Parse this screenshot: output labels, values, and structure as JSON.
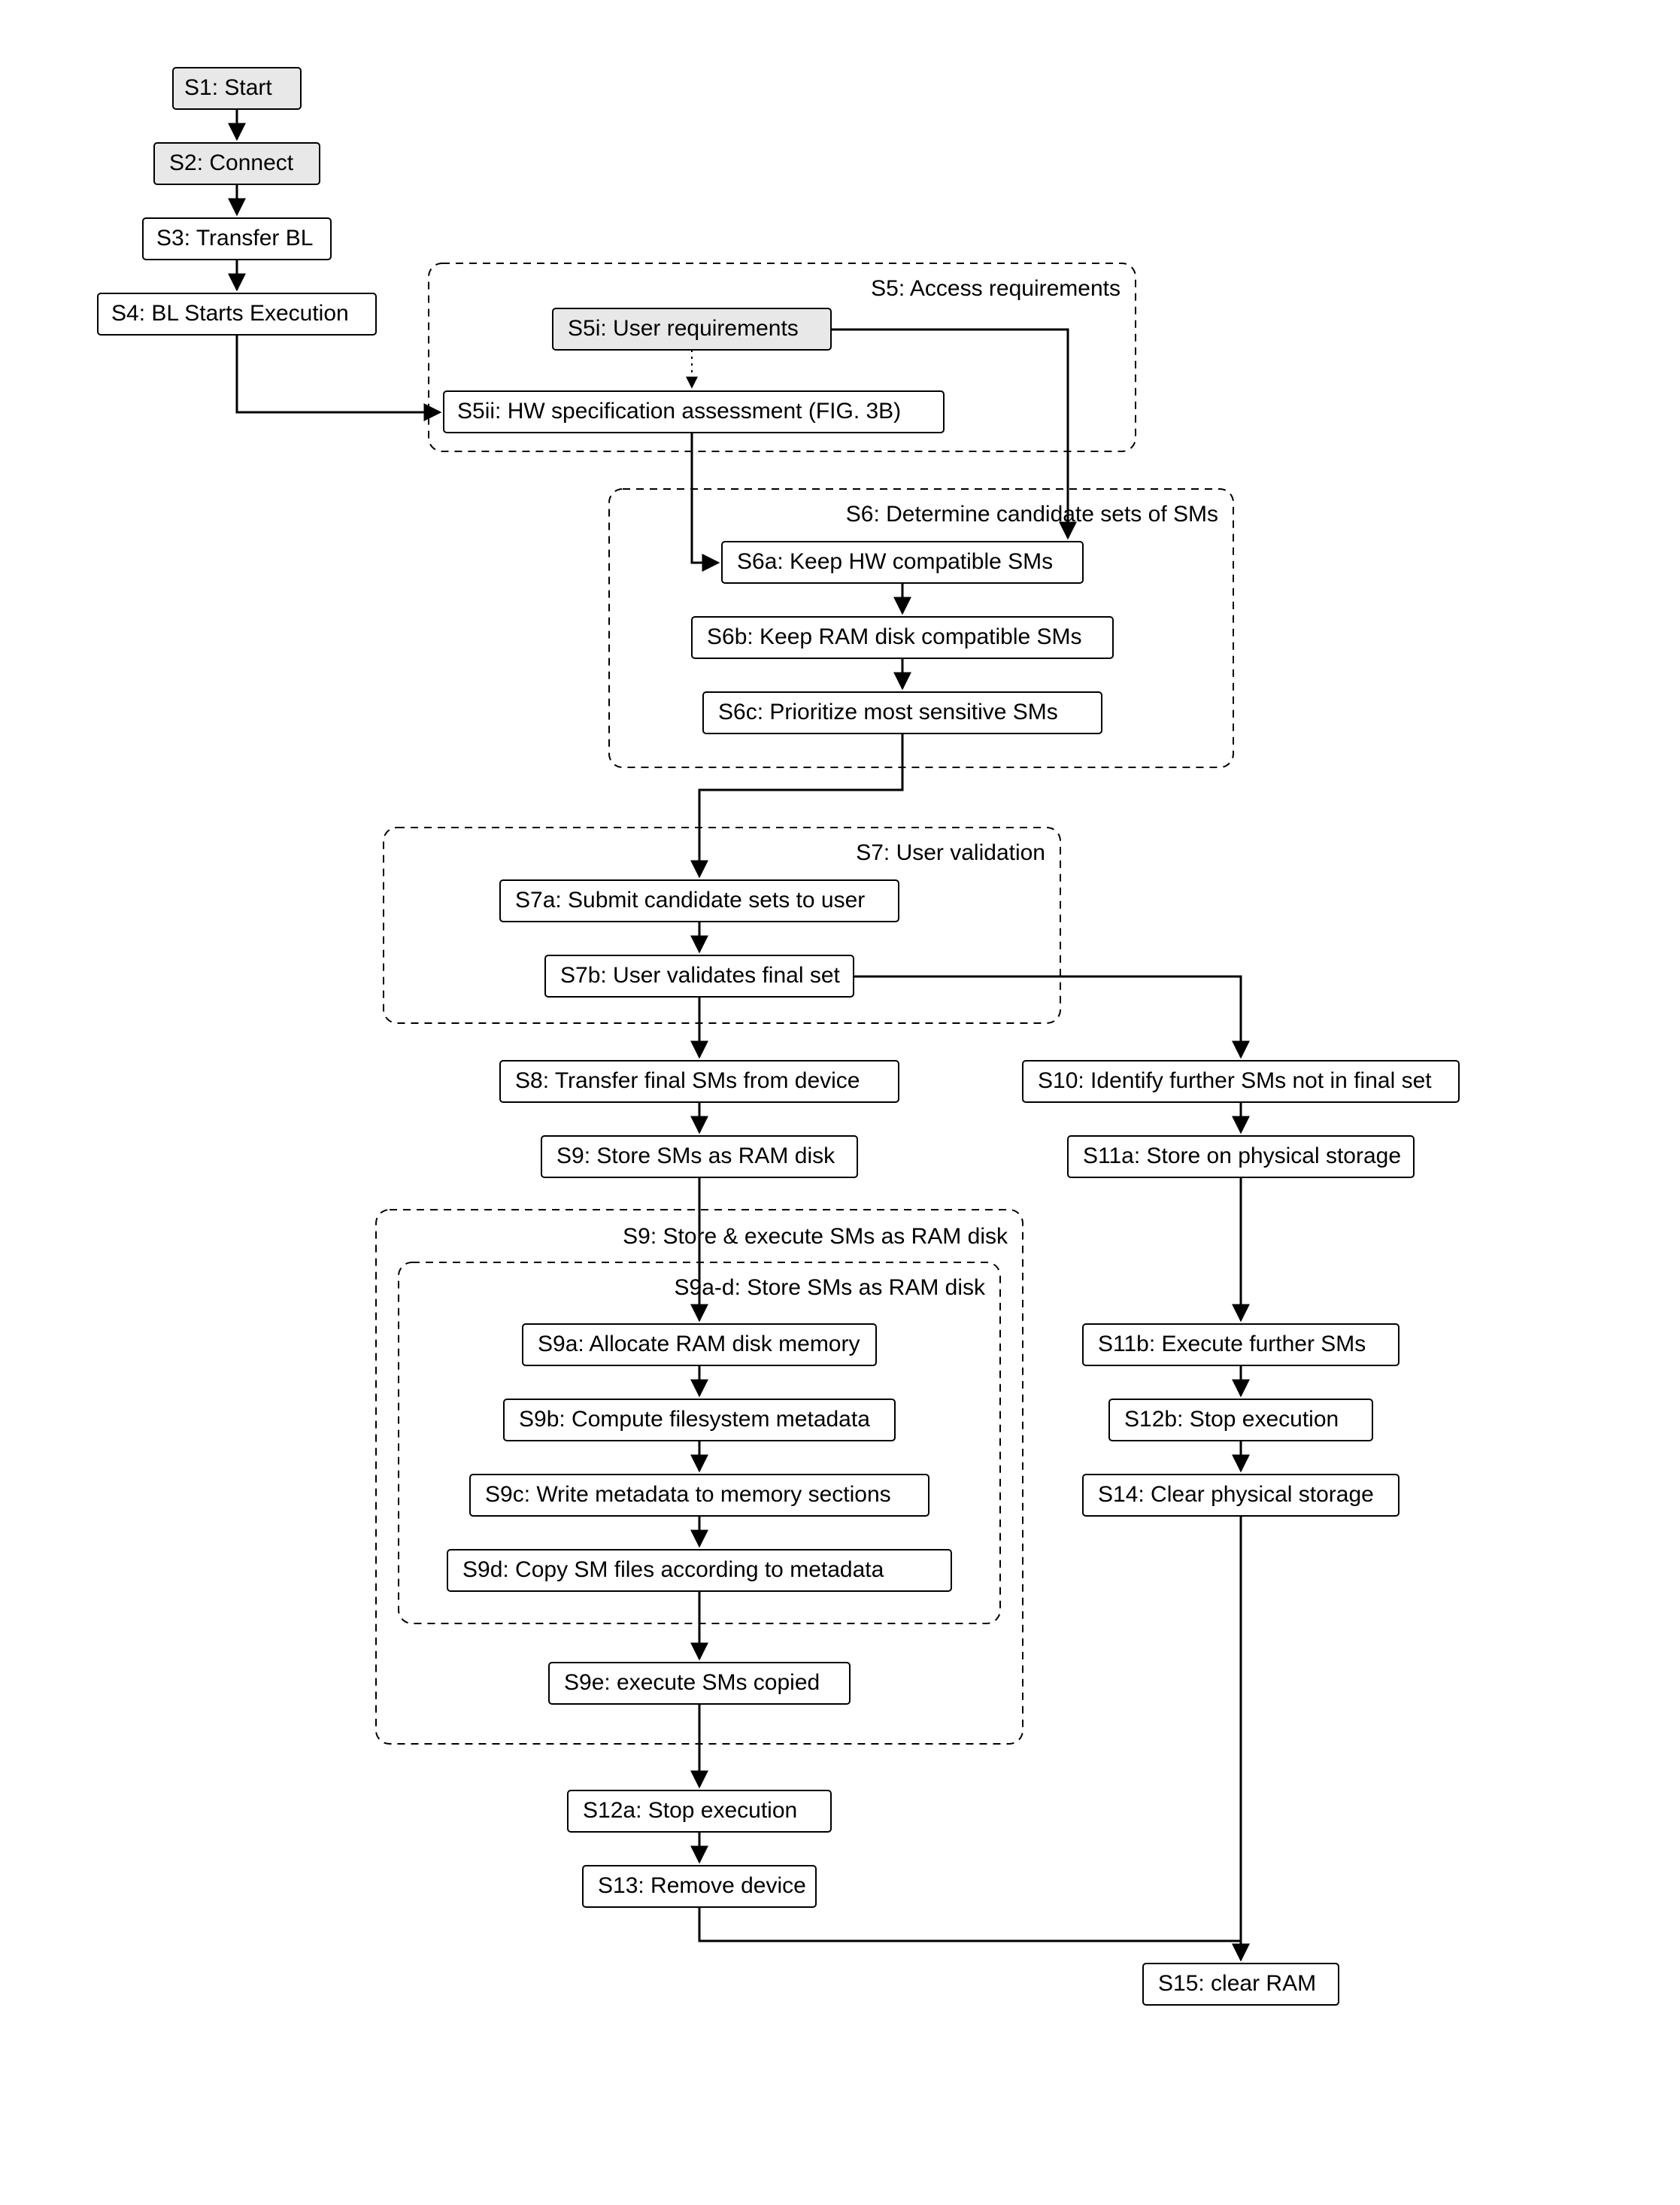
{
  "chart_data": {
    "type": "flowchart",
    "nodes": [
      {
        "id": "S1",
        "label": "S1: Start"
      },
      {
        "id": "S2",
        "label": "S2: Connect"
      },
      {
        "id": "S3",
        "label": "S3: Transfer BL"
      },
      {
        "id": "S4",
        "label": "S4: BL Starts Execution"
      },
      {
        "id": "S5",
        "label": "S5: Access requirements",
        "group": true,
        "children": [
          "S5i",
          "S5ii"
        ]
      },
      {
        "id": "S5i",
        "label": "S5i: User requirements"
      },
      {
        "id": "S5ii",
        "label": "S5ii: HW specification assessment (FIG. 3B)"
      },
      {
        "id": "S6",
        "label": "S6: Determine candidate sets of SMs",
        "group": true,
        "children": [
          "S6a",
          "S6b",
          "S6c"
        ]
      },
      {
        "id": "S6a",
        "label": "S6a: Keep HW compatible SMs"
      },
      {
        "id": "S6b",
        "label": "S6b: Keep RAM disk compatible SMs"
      },
      {
        "id": "S6c",
        "label": "S6c: Prioritize most sensitive SMs"
      },
      {
        "id": "S7",
        "label": "S7: User validation",
        "group": true,
        "children": [
          "S7a",
          "S7b"
        ]
      },
      {
        "id": "S7a",
        "label": "S7a: Submit candidate sets to user"
      },
      {
        "id": "S7b",
        "label": "S7b: User validates final set"
      },
      {
        "id": "S8",
        "label": "S8: Transfer final SMs from device"
      },
      {
        "id": "S9t",
        "label": "S9: Store SMs as RAM disk"
      },
      {
        "id": "S9g",
        "label": "S9: Store & execute SMs as RAM disk",
        "group": true,
        "children": [
          "S9ad",
          "S9e"
        ]
      },
      {
        "id": "S9ad",
        "label": "S9a-d: Store SMs as RAM disk",
        "group": true,
        "children": [
          "S9a",
          "S9b",
          "S9c",
          "S9d"
        ]
      },
      {
        "id": "S9a",
        "label": "S9a: Allocate RAM disk memory"
      },
      {
        "id": "S9b",
        "label": "S9b: Compute filesystem metadata"
      },
      {
        "id": "S9c",
        "label": "S9c: Write metadata to memory sections"
      },
      {
        "id": "S9d",
        "label": "S9d: Copy SM files according to metadata"
      },
      {
        "id": "S9e",
        "label": "S9e: execute SMs copied"
      },
      {
        "id": "S12a",
        "label": "S12a: Stop execution"
      },
      {
        "id": "S13",
        "label": "S13: Remove device"
      },
      {
        "id": "S10",
        "label": "S10: Identify further SMs not in final set"
      },
      {
        "id": "S11a",
        "label": "S11a: Store on physical storage"
      },
      {
        "id": "S11b",
        "label": "S11b: Execute further SMs"
      },
      {
        "id": "S12b",
        "label": "S12b: Stop execution"
      },
      {
        "id": "S14",
        "label": "S14: Clear physical storage"
      },
      {
        "id": "S15",
        "label": "S15: clear RAM"
      }
    ],
    "edges": [
      [
        "S1",
        "S2"
      ],
      [
        "S2",
        "S3"
      ],
      [
        "S3",
        "S4"
      ],
      [
        "S4",
        "S5ii"
      ],
      [
        "S5i",
        "S5ii",
        "dotted"
      ],
      [
        "S5i",
        "S6a"
      ],
      [
        "S5ii",
        "S6a"
      ],
      [
        "S6a",
        "S6b"
      ],
      [
        "S6b",
        "S6c"
      ],
      [
        "S6c",
        "S7a"
      ],
      [
        "S7a",
        "S7b"
      ],
      [
        "S7b",
        "S8"
      ],
      [
        "S8",
        "S9t"
      ],
      [
        "S9t",
        "S9a"
      ],
      [
        "S9a",
        "S9b"
      ],
      [
        "S9b",
        "S9c"
      ],
      [
        "S9c",
        "S9d"
      ],
      [
        "S9d",
        "S9e"
      ],
      [
        "S9e",
        "S12a"
      ],
      [
        "S12a",
        "S13"
      ],
      [
        "S13",
        "S15"
      ],
      [
        "S7b",
        "S10"
      ],
      [
        "S10",
        "S11a"
      ],
      [
        "S11a",
        "S11b"
      ],
      [
        "S11b",
        "S12b"
      ],
      [
        "S12b",
        "S14"
      ],
      [
        "S14",
        "S15"
      ]
    ]
  },
  "n": {
    "s1": "S1: Start",
    "s2": "S2: Connect",
    "s3": "S3: Transfer BL",
    "s4": "S4: BL Starts Execution",
    "s5": "S5: Access requirements",
    "s5i": "S5i: User requirements",
    "s5ii": "S5ii: HW specification assessment (FIG. 3B)",
    "s6": "S6: Determine candidate sets of SMs",
    "s6a": "S6a: Keep HW compatible SMs",
    "s6b": "S6b: Keep RAM disk compatible SMs",
    "s6c": "S6c: Prioritize most sensitive SMs",
    "s7": "S7: User validation",
    "s7a": "S7a: Submit candidate sets to user",
    "s7b": "S7b: User validates final set",
    "s8": "S8: Transfer final SMs from device",
    "s9t": "S9: Store SMs as RAM disk",
    "s9g": "S9: Store & execute SMs as RAM disk",
    "s9ad": "S9a-d: Store SMs as RAM disk",
    "s9a": "S9a: Allocate RAM disk memory",
    "s9b": "S9b: Compute filesystem metadata",
    "s9c": "S9c: Write metadata to memory sections",
    "s9d": "S9d: Copy SM files according to metadata",
    "s9e": "S9e: execute SMs copied",
    "s12a": "S12a: Stop execution",
    "s13": "S13: Remove device",
    "s10": "S10: Identify further SMs not in final set",
    "s11a": "S11a: Store on physical storage",
    "s11b": "S11b: Execute further SMs",
    "s12b": "S12b: Stop execution",
    "s14": "S14: Clear physical storage",
    "s15": "S15: clear RAM"
  }
}
